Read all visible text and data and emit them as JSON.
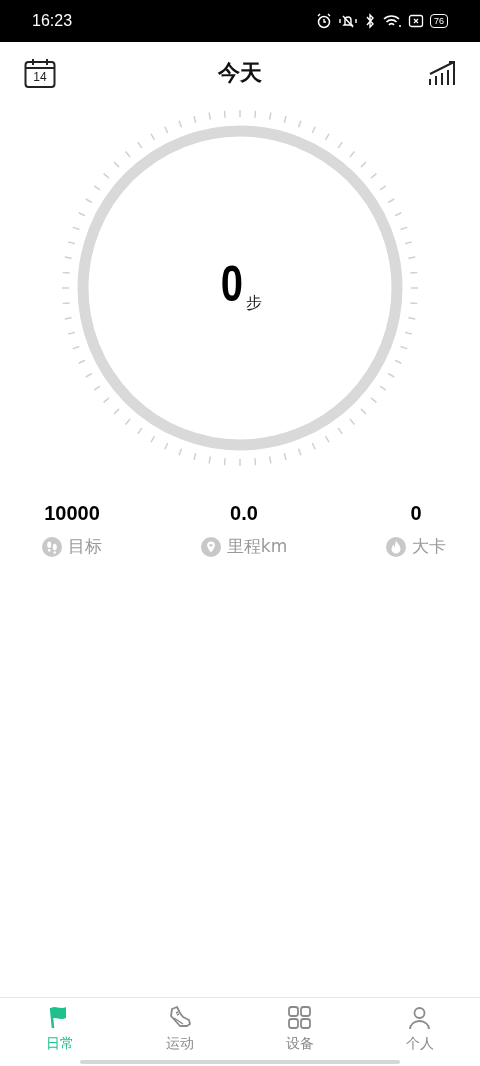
{
  "status_bar": {
    "time": "16:23",
    "battery": "76"
  },
  "header": {
    "title": "今天",
    "calendar_day": "14"
  },
  "steps": {
    "value": "0",
    "unit": "步"
  },
  "stats": [
    {
      "kind": "goal",
      "value": "10000",
      "label": "目标"
    },
    {
      "kind": "distance",
      "value": "0.0",
      "label": "里程km"
    },
    {
      "kind": "calories",
      "value": "0",
      "label": "大卡"
    }
  ],
  "tabs": [
    {
      "kind": "daily",
      "label": "日常",
      "selected": true
    },
    {
      "kind": "sport",
      "label": "运动",
      "selected": false
    },
    {
      "kind": "device",
      "label": "设备",
      "selected": false
    },
    {
      "kind": "profile",
      "label": "个人",
      "selected": false
    }
  ]
}
